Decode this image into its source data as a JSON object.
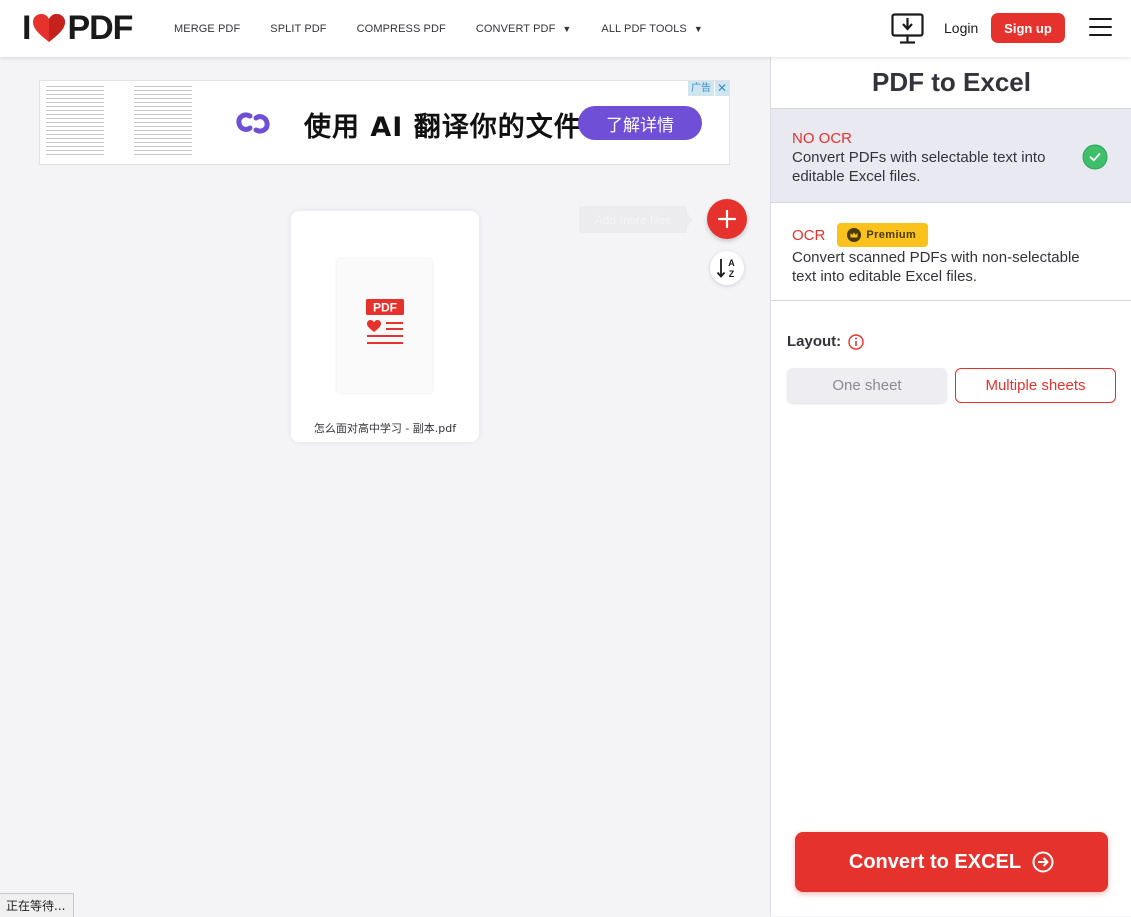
{
  "header": {
    "logo": {
      "left": "I",
      "right": "PDF",
      "icon": "heart-icon"
    },
    "nav": [
      {
        "label": "MERGE PDF",
        "dropdown": false
      },
      {
        "label": "SPLIT PDF",
        "dropdown": false
      },
      {
        "label": "COMPRESS PDF",
        "dropdown": false
      },
      {
        "label": "CONVERT PDF",
        "dropdown": true
      },
      {
        "label": "ALL PDF TOOLS",
        "dropdown": true
      }
    ],
    "desktop_icon": "desktop-download-icon",
    "login": "Login",
    "signup": "Sign up",
    "menu_icon": "hamburger-menu-icon"
  },
  "ad": {
    "headline": "使用 AI 翻译你的文件",
    "cta": "了解详情",
    "badge": "广告",
    "close": "✕"
  },
  "workspace": {
    "file": {
      "name": "怎么面对高中学习 - 副本.pdf",
      "icon_label": "PDF"
    },
    "add_more_tooltip": "Add more files",
    "add_icon": "plus-icon",
    "sort_icon": "sort-az-icon"
  },
  "panel": {
    "title": "PDF to Excel",
    "options": [
      {
        "title": "NO OCR",
        "description": "Convert PDFs with selectable text into editable Excel files.",
        "selected": true
      },
      {
        "title": "OCR",
        "badge": "Premium",
        "description": "Convert scanned PDFs with non-selectable text into editable Excel files.",
        "selected": false
      }
    ],
    "layout_label": "Layout:",
    "layout_options": [
      {
        "label": "One sheet",
        "selected": false
      },
      {
        "label": "Multiple sheets",
        "selected": true
      }
    ],
    "convert_button": "Convert to EXCEL"
  },
  "status_bar": "正在等待...",
  "colors": {
    "brand_red": "#e5322d",
    "ad_purple": "#6f4fd6",
    "premium_yellow": "#f9c21c",
    "check_green": "#3fbf6a"
  }
}
